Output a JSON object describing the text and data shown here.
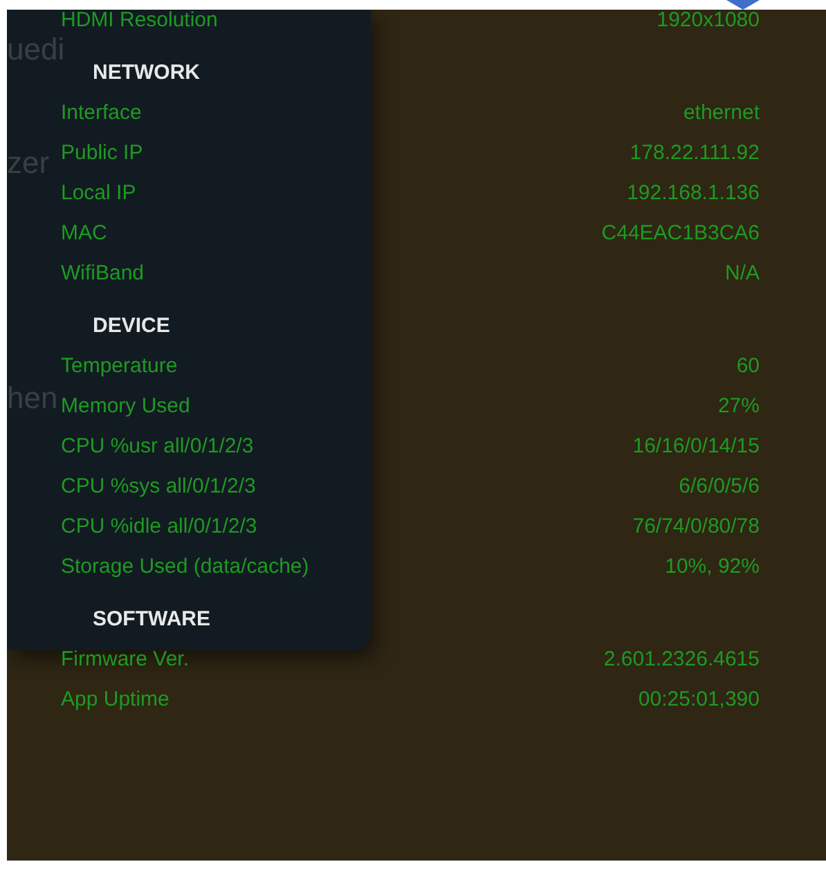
{
  "background_text": [
    "uedi",
    "zer",
    "hen"
  ],
  "items": [
    {
      "kind": "row",
      "label": "HDMI Resolution",
      "value": "1920x1080"
    },
    {
      "kind": "heading",
      "label": "NETWORK"
    },
    {
      "kind": "row",
      "label": "Interface",
      "value": "ethernet"
    },
    {
      "kind": "row",
      "label": "Public IP",
      "value": "178.22.111.92"
    },
    {
      "kind": "row",
      "label": "Local IP",
      "value": "192.168.1.136"
    },
    {
      "kind": "row",
      "label": "MAC",
      "value": "C44EAC1B3CA6"
    },
    {
      "kind": "row",
      "label": "WifiBand",
      "value": "N/A"
    },
    {
      "kind": "heading",
      "label": "DEVICE"
    },
    {
      "kind": "row",
      "label": "Temperature",
      "value": "60"
    },
    {
      "kind": "row",
      "label": "Memory Used",
      "value": "27%"
    },
    {
      "kind": "row",
      "label": "CPU %usr all/0/1/2/3",
      "value": "16/16/0/14/15"
    },
    {
      "kind": "row",
      "label": "CPU %sys all/0/1/2/3",
      "value": "6/6/0/5/6"
    },
    {
      "kind": "row",
      "label": "CPU %idle all/0/1/2/3",
      "value": "76/74/0/80/78"
    },
    {
      "kind": "row",
      "label": "Storage Used (data/cache)",
      "value": "10%, 92%"
    },
    {
      "kind": "heading",
      "label": "SOFTWARE"
    },
    {
      "kind": "row",
      "label": "Firmware Ver.",
      "value": "2.601.2326.4615"
    },
    {
      "kind": "row",
      "label": "App Uptime",
      "value": "00:25:01,390"
    }
  ]
}
